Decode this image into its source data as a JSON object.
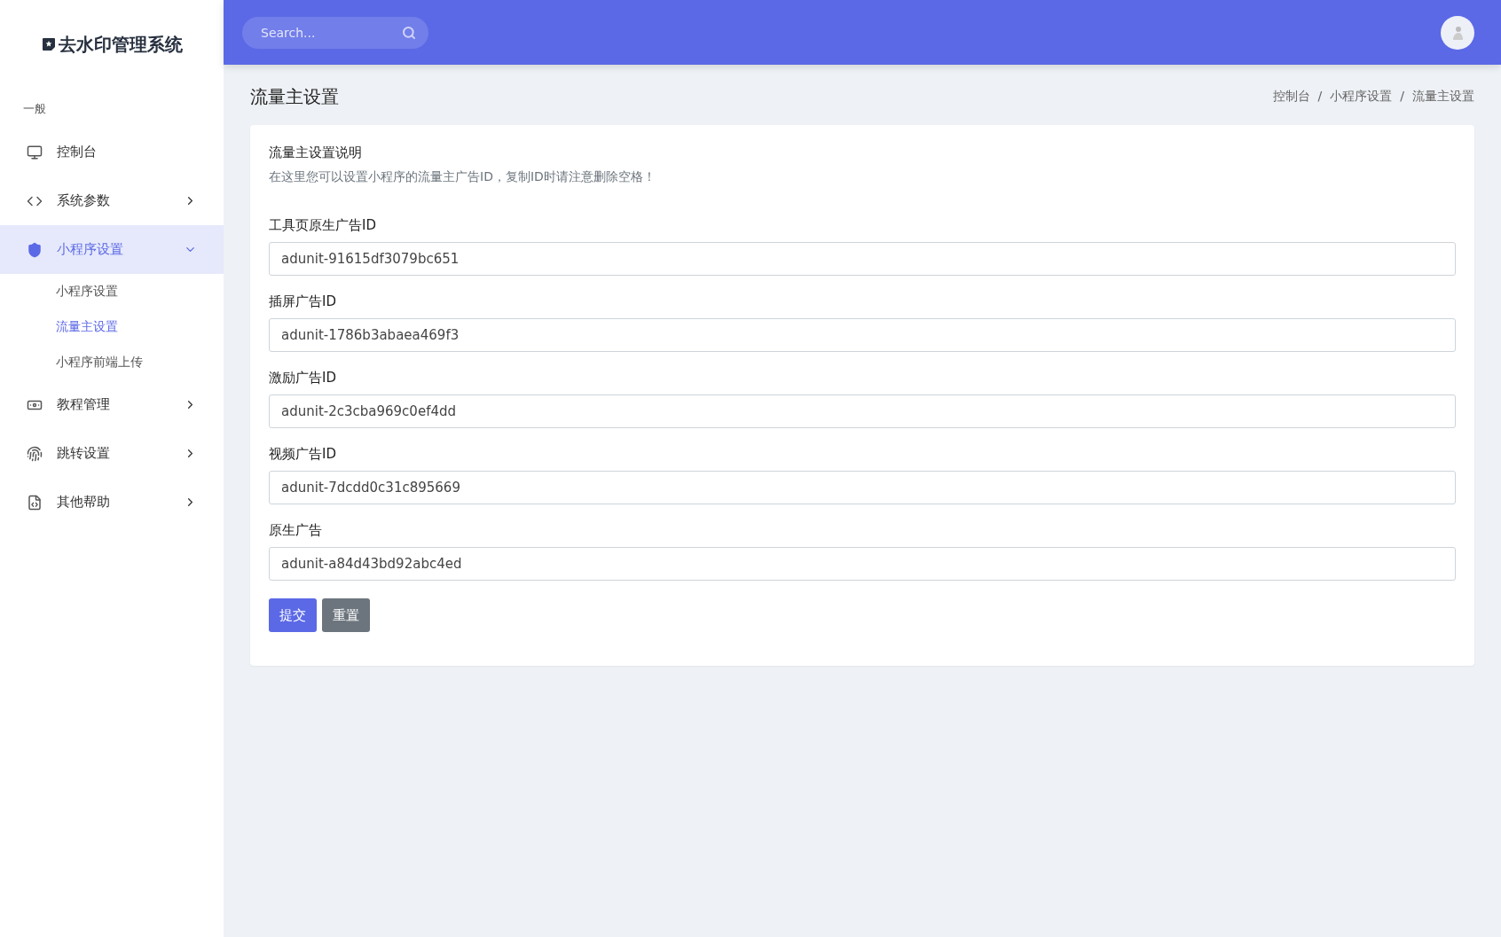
{
  "app": {
    "title": "去水印管理系统"
  },
  "sidebar": {
    "section": "一般",
    "items": [
      {
        "label": "控制台",
        "selected": false
      },
      {
        "label": "系统参数",
        "selected": false,
        "expanded": false
      },
      {
        "label": "小程序设置",
        "selected": true,
        "expanded": true,
        "children": [
          {
            "label": "小程序设置",
            "selected": false
          },
          {
            "label": "流量主设置",
            "selected": true
          },
          {
            "label": "小程序前端上传",
            "selected": false
          }
        ]
      },
      {
        "label": "教程管理",
        "selected": false,
        "expanded": false
      },
      {
        "label": "跳转设置",
        "selected": false,
        "expanded": false
      },
      {
        "label": "其他帮助",
        "selected": false,
        "expanded": false
      }
    ]
  },
  "header": {
    "search": {
      "placeholder": "Search..."
    }
  },
  "page": {
    "title": "流量主设置",
    "breadcrumb": [
      "控制台",
      "小程序设置",
      "流量主设置"
    ],
    "breadcrumb_separator": "/"
  },
  "card": {
    "title": "流量主设置说明",
    "description": "在这里您可以设置小程序的流量主广告ID，复制ID时请注意删除空格！",
    "fields": [
      {
        "label": "工具页原生广告ID",
        "value": "adunit-91615df3079bc651"
      },
      {
        "label": "插屏广告ID",
        "value": "adunit-1786b3abaea469f3"
      },
      {
        "label": "激励广告ID",
        "value": "adunit-2c3cba969c0ef4dd"
      },
      {
        "label": "视频广告ID",
        "value": "adunit-7dcdd0c31c895669"
      },
      {
        "label": "原生广告",
        "value": "adunit-a84d43bd92abc4ed"
      }
    ],
    "buttons": [
      {
        "label": "提交",
        "kind": "primary"
      },
      {
        "label": "重置",
        "kind": "secondary"
      }
    ]
  }
}
